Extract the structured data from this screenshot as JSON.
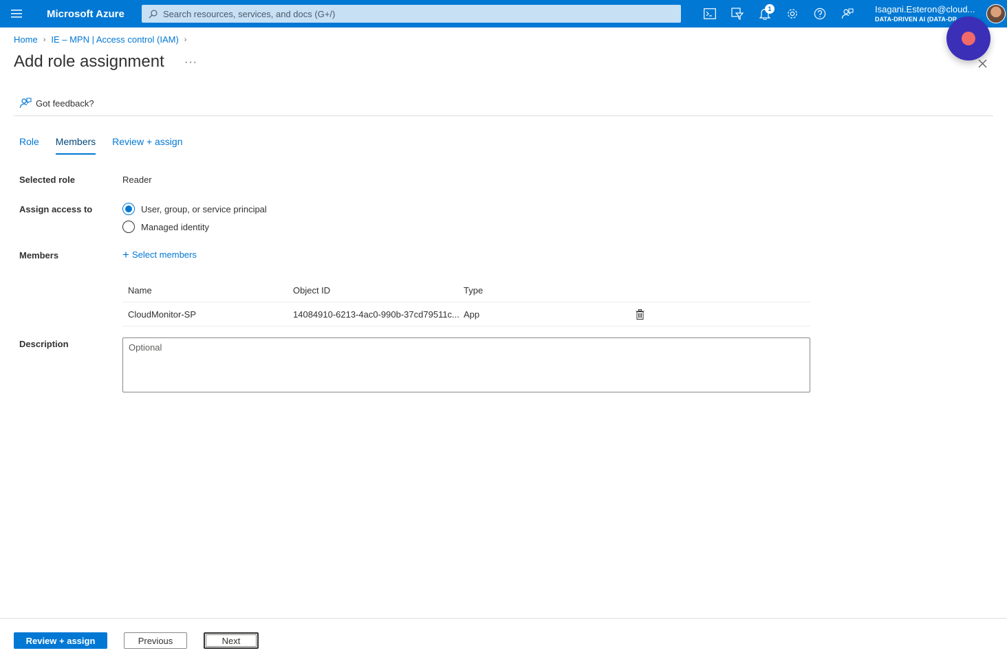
{
  "topbar": {
    "brand": "Microsoft Azure",
    "search_placeholder": "Search resources, services, and docs (G+/)",
    "notification_count": "1",
    "account_name": "Isagani.Esteron@cloud...",
    "account_tenant": "DATA-DRIVEN AI (DATA-DR"
  },
  "breadcrumb": {
    "home": "Home",
    "parent": "IE – MPN | Access control (IAM)"
  },
  "page": {
    "title": "Add role assignment",
    "more": "···",
    "feedback": "Got feedback?"
  },
  "tabs": [
    {
      "label": "Role"
    },
    {
      "label": "Members"
    },
    {
      "label": "Review + assign"
    }
  ],
  "form": {
    "selected_role_label": "Selected role",
    "selected_role_value": "Reader",
    "assign_access_label": "Assign access to",
    "option_user": "User, group, or service principal",
    "option_managed": "Managed identity",
    "members_label": "Members",
    "select_members": "Select members",
    "description_label": "Description",
    "description_placeholder": "Optional"
  },
  "table": {
    "headers": {
      "name": "Name",
      "object_id": "Object ID",
      "type": "Type"
    },
    "rows": [
      {
        "name": "CloudMonitor-SP",
        "object_id": "14084910-6213-4ac0-990b-37cd79511c...",
        "type": "App"
      }
    ]
  },
  "footer": {
    "review_assign": "Review + assign",
    "previous": "Previous",
    "next": "Next"
  },
  "colors": {
    "accent": "#0078d4",
    "record": "#3b2fb8"
  }
}
